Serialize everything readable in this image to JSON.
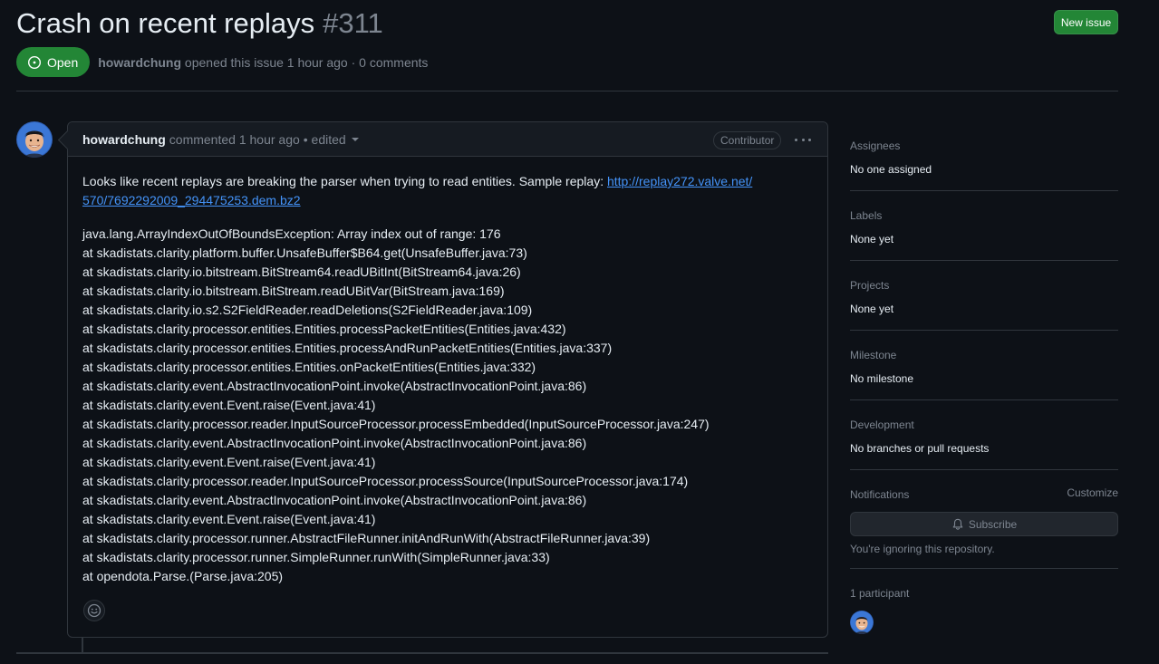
{
  "issue": {
    "title": "Crash on recent replays",
    "number": "#311",
    "state": "Open",
    "author": "howardchung",
    "meta_suffix": "opened this issue 1 hour ago · 0 comments"
  },
  "header": {
    "new_issue_label": "New issue"
  },
  "comment": {
    "author": "howardchung",
    "time": "commented 1 hour ago",
    "edited": "• edited",
    "role": "Contributor",
    "intro": "Looks like recent replays are breaking the parser when trying to read entities. Sample replay: ",
    "link_line1": "http://replay272.valve.net/",
    "link_line2": "570/7692292009_294475253.dem.bz2",
    "stack_trace": [
      "java.lang.ArrayIndexOutOfBoundsException: Array index out of range: 176",
      "at skadistats.clarity.platform.buffer.UnsafeBuffer$B64.get(UnsafeBuffer.java:73)",
      "at skadistats.clarity.io.bitstream.BitStream64.readUBitInt(BitStream64.java:26)",
      "at skadistats.clarity.io.bitstream.BitStream.readUBitVar(BitStream.java:169)",
      "at skadistats.clarity.io.s2.S2FieldReader.readDeletions(S2FieldReader.java:109)",
      "at skadistats.clarity.processor.entities.Entities.processPacketEntities(Entities.java:432)",
      "at skadistats.clarity.processor.entities.Entities.processAndRunPacketEntities(Entities.java:337)",
      "at skadistats.clarity.processor.entities.Entities.onPacketEntities(Entities.java:332)",
      "at skadistats.clarity.event.AbstractInvocationPoint.invoke(AbstractInvocationPoint.java:86)",
      "at skadistats.clarity.event.Event.raise(Event.java:41)",
      "at skadistats.clarity.processor.reader.InputSourceProcessor.processEmbedded(InputSourceProcessor.java:247)",
      "at skadistats.clarity.event.AbstractInvocationPoint.invoke(AbstractInvocationPoint.java:86)",
      "at skadistats.clarity.event.Event.raise(Event.java:41)",
      "at skadistats.clarity.processor.reader.InputSourceProcessor.processSource(InputSourceProcessor.java:174)",
      "at skadistats.clarity.event.AbstractInvocationPoint.invoke(AbstractInvocationPoint.java:86)",
      "at skadistats.clarity.event.Event.raise(Event.java:41)",
      "at skadistats.clarity.processor.runner.AbstractFileRunner.initAndRunWith(AbstractFileRunner.java:39)",
      "at skadistats.clarity.processor.runner.SimpleRunner.runWith(SimpleRunner.java:33)",
      "at opendota.Parse.(Parse.java:205)"
    ]
  },
  "sidebar": {
    "assignees": {
      "heading": "Assignees",
      "value": "No one assigned"
    },
    "labels": {
      "heading": "Labels",
      "value": "None yet"
    },
    "projects": {
      "heading": "Projects",
      "value": "None yet"
    },
    "milestone": {
      "heading": "Milestone",
      "value": "No milestone"
    },
    "development": {
      "heading": "Development",
      "value": "No branches or pull requests"
    },
    "notifications": {
      "heading": "Notifications",
      "customize": "Customize",
      "subscribe": "Subscribe",
      "status": "You're ignoring this repository."
    },
    "participants": {
      "heading": "1 participant"
    }
  },
  "icons": {
    "state": "issue-opened-icon",
    "caret": "triangle-down-icon",
    "menu": "kebab-horizontal-icon",
    "reaction": "smiley-icon",
    "subscribe": "bell-icon"
  },
  "colors": {
    "background": "#0d1117",
    "accent_green": "#238636",
    "link": "#4493f8",
    "muted": "#7d8590",
    "border": "#30363d"
  }
}
